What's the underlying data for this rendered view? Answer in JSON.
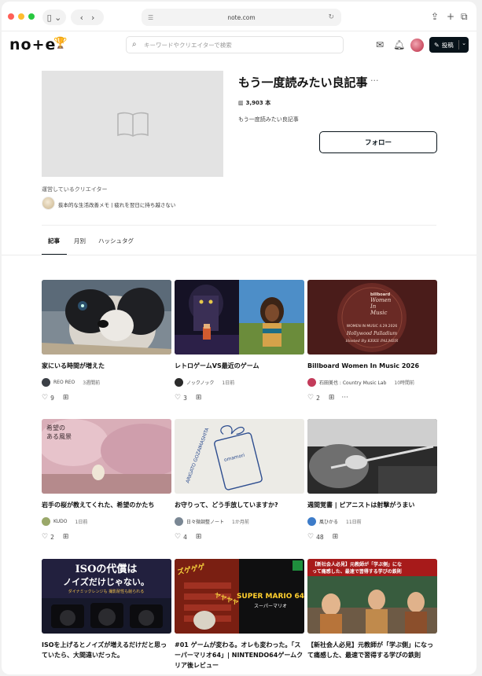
{
  "browser": {
    "url": "note.com",
    "colors": {
      "close": "#ff5f57",
      "minimize": "#febc2e",
      "zoom": "#28c840"
    }
  },
  "header": {
    "logo": "no+e",
    "search_placeholder": "キーワードやクリエイターで検索",
    "post_label": "投稿",
    "accent": "#08131a"
  },
  "magazine": {
    "title": "もう一度読みたい良記事",
    "count": "3,903 本",
    "description": "もう一度読みたい良記事",
    "follow_label": "フォロー",
    "creator_label": "運営しているクリエイター",
    "creator_name": "抜本的な生活改善メモ | 疲れを翌日に持ち越さない"
  },
  "tabs": [
    {
      "label": "記事",
      "active": true
    },
    {
      "label": "月別",
      "active": false
    },
    {
      "label": "ハッシュタグ",
      "active": false
    }
  ],
  "articles": [
    {
      "title": "家にいる時間が増えた",
      "author": "REO REO",
      "date": "3週間前",
      "likes": "9",
      "thumb": "dog",
      "avatar_color": "#3b3f46"
    },
    {
      "title": "レトロゲームVS最近のゲーム",
      "author": "ノックノック",
      "date": "1日前",
      "likes": "3",
      "thumb": "game",
      "avatar_color": "#2b2b2b"
    },
    {
      "title": "Billboard Women In Music 2026",
      "author": "石田美也 : Country Music Lab",
      "date": "10時間前",
      "likes": "2",
      "thumb": "billboard",
      "avatar_color": "#c33b5a",
      "thumb_text": {
        "brand": "billboard",
        "line1": "Women",
        "line2": "In",
        "line3": "Music",
        "line4": "WOMEN IN MUSIC 4.29.2026",
        "line5": "Hollywood Palladium",
        "line6": "Hosted By KEKE PALMER"
      }
    },
    {
      "title": "岩手の桜が教えてくれた、希望のかたち",
      "author": "KUDO",
      "date": "1日前",
      "likes": "2",
      "thumb": "sakura",
      "avatar_color": "#9aa86a",
      "thumb_text": {
        "line1": "希望の",
        "line2": "ある風景"
      }
    },
    {
      "title": "お守りって、どう手放していますか?",
      "author": "日々微調整ノート",
      "date": "1か月前",
      "likes": "4",
      "thumb": "omamori",
      "avatar_color": "#7a8794",
      "thumb_text": {
        "line1": "omamori",
        "line2": "ARIGATO GOZAIMASHITA"
      }
    },
    {
      "title": "週間覚書 | ピアニストは射撃がうまい",
      "author": "風ひかる",
      "date": "11日前",
      "likes": "48",
      "thumb": "rifle",
      "avatar_color": "#3d7cc9"
    },
    {
      "title": "ISOを上げるとノイズが増えるだけだと思っていたら、大間違いだった。",
      "author": "",
      "date": "",
      "likes": "",
      "thumb": "iso",
      "avatar_color": "#333",
      "thumb_text": {
        "line1": "ISOの代償は",
        "line2": "ノイズだけじゃない。",
        "line3": "ダイナミックレンジも 撮影耐性も削られる"
      }
    },
    {
      "title": "#01 ゲームが変わる。オレも変わった。「スーパーマリオ64」| NINTENDO64ゲームクリア後レビュー",
      "author": "",
      "date": "",
      "likes": "",
      "thumb": "mario",
      "avatar_color": "#333",
      "thumb_text": {
        "line1": "ズゲゲゲ",
        "line2": "ヤヤヤヤ",
        "line3": "SUPER MARIO 64",
        "line4": "スーパーマリオ"
      }
    },
    {
      "title": "【新社会人必見】元教師が「学ぶ側」になって痛感した、最速で習得する学びの鉄則",
      "author": "",
      "date": "",
      "likes": "",
      "thumb": "teacher",
      "avatar_color": "#333",
      "thumb_text": {
        "line1": "【新社会人必見】元教師が「学ぶ側」にな",
        "line2": "って痛感した、最速で習得する学びの鉄則"
      }
    }
  ]
}
